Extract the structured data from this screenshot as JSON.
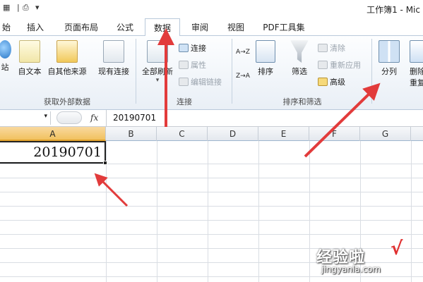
{
  "titlebar": {
    "title": "工作簿1 - Mic",
    "quick_access_icons": [
      "save-icon",
      "print-icon",
      "customize-arrow-icon"
    ]
  },
  "tabs": [
    {
      "label": "始"
    },
    {
      "label": "插入"
    },
    {
      "label": "页面布局"
    },
    {
      "label": "公式"
    },
    {
      "label": "数据",
      "active": true
    },
    {
      "label": "审阅"
    },
    {
      "label": "视图"
    },
    {
      "label": "PDF工具集"
    }
  ],
  "ribbon": {
    "external_data": {
      "group_label": "获取外部数据",
      "web_label": "站",
      "text_label": "自文本",
      "other_label": "自其他来源",
      "existing_label": "现有连接"
    },
    "connections": {
      "group_label": "连接",
      "refresh_all_label": "全部刷新",
      "connections_label": "连接",
      "properties_label": "属性",
      "edit_links_label": "编辑链接"
    },
    "sort_filter": {
      "group_label": "排序和筛选",
      "sort_asc_label": "A→Z",
      "sort_desc_label": "Z→A",
      "sort_label": "排序",
      "filter_label": "筛选",
      "clear_label": "清除",
      "reapply_label": "重新应用",
      "advanced_label": "高级"
    },
    "data_tools": {
      "text_to_columns_label": "分列",
      "remove_dup_label": "删除",
      "remove_dup_label2": "重复"
    }
  },
  "formula_bar": {
    "fx_label": "fx",
    "value": "20190701"
  },
  "grid": {
    "columns": [
      "A",
      "B",
      "C",
      "D",
      "E",
      "F",
      "G"
    ],
    "selected_column": "A",
    "cell_a1": "20190701"
  },
  "watermark": {
    "brand": "经验啦",
    "check": "√",
    "url": "jingyanla.com"
  },
  "annotation_color": "#e23b3b"
}
